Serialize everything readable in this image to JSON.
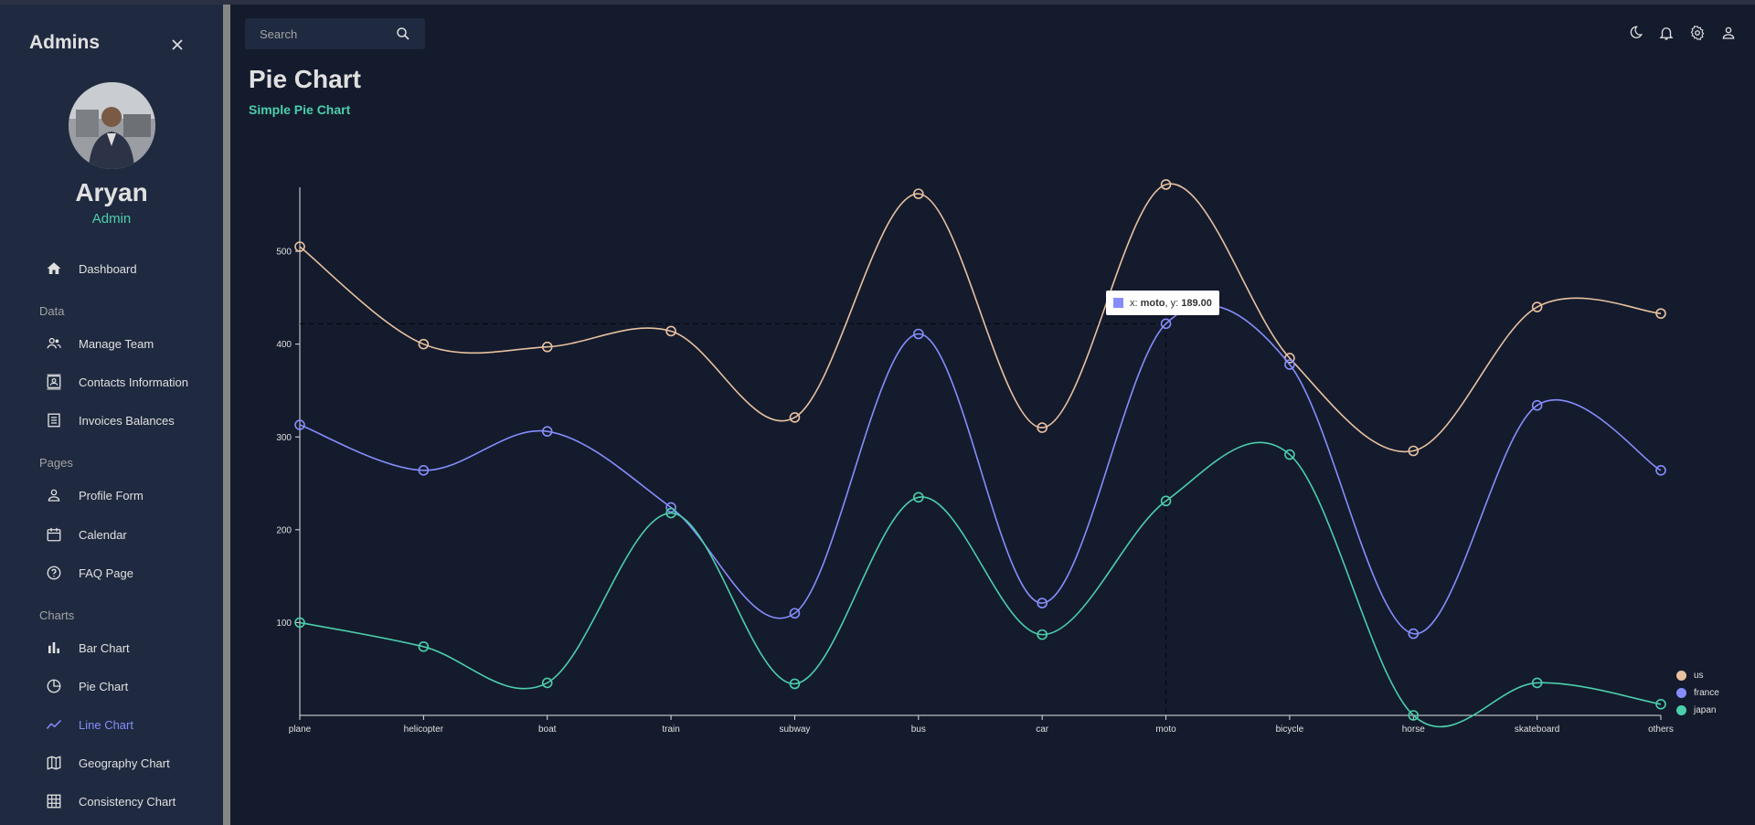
{
  "sidebar": {
    "brand": "Admins",
    "user": {
      "name": "Aryan",
      "role": "Admin"
    },
    "items": [
      {
        "label": "Dashboard",
        "icon": "home-icon"
      },
      {
        "section": "Data"
      },
      {
        "label": "Manage Team",
        "icon": "people-icon"
      },
      {
        "label": "Contacts Information",
        "icon": "contacts-icon"
      },
      {
        "label": "Invoices Balances",
        "icon": "receipt-icon"
      },
      {
        "section": "Pages"
      },
      {
        "label": "Profile Form",
        "icon": "person-icon"
      },
      {
        "label": "Calendar",
        "icon": "calendar-icon"
      },
      {
        "label": "FAQ Page",
        "icon": "help-icon"
      },
      {
        "section": "Charts"
      },
      {
        "label": "Bar Chart",
        "icon": "bar-chart-icon"
      },
      {
        "label": "Pie Chart",
        "icon": "pie-chart-icon"
      },
      {
        "label": "Line Chart",
        "icon": "timeline-icon",
        "active": true
      },
      {
        "label": "Geography Chart",
        "icon": "map-icon"
      },
      {
        "label": "Consistency Chart",
        "icon": "grid-icon"
      }
    ]
  },
  "topbar": {
    "search_placeholder": "Search",
    "icons": [
      "moon-icon",
      "bell-icon",
      "settings-icon",
      "person-icon"
    ]
  },
  "header": {
    "title": "Pie Chart",
    "subtitle": "Simple Pie Chart"
  },
  "colors": {
    "accent": "#4cceac",
    "active": "#868dfb",
    "bg": "#141b2d",
    "panel": "#1f2a40"
  },
  "tooltip": {
    "x_label": "x:",
    "x_value": "moto",
    "y_label": ", y:",
    "y_value": "189.00"
  },
  "chart_data": {
    "type": "line",
    "categories": [
      "plane",
      "helicopter",
      "boat",
      "train",
      "subway",
      "bus",
      "car",
      "moto",
      "bicycle",
      "horse",
      "skateboard",
      "others"
    ],
    "series": [
      {
        "name": "us",
        "color": "#e8c1a0",
        "values": [
          505,
          400,
          397,
          414,
          321,
          562,
          310,
          572,
          385,
          285,
          440,
          433
        ]
      },
      {
        "name": "france",
        "color": "#868dfb",
        "values": [
          313,
          264,
          306,
          224,
          110,
          411,
          121,
          422,
          378,
          88,
          334,
          264
        ]
      },
      {
        "name": "japan",
        "color": "#4cceac",
        "values": [
          100,
          74,
          35,
          218,
          34,
          235,
          87,
          231,
          281,
          0,
          35,
          12
        ]
      }
    ],
    "yticks": [
      100,
      200,
      300,
      400,
      500
    ],
    "ylim": [
      0,
      570
    ],
    "legend": "bottom-right",
    "highlight": {
      "category": "moto",
      "series": "france"
    }
  }
}
